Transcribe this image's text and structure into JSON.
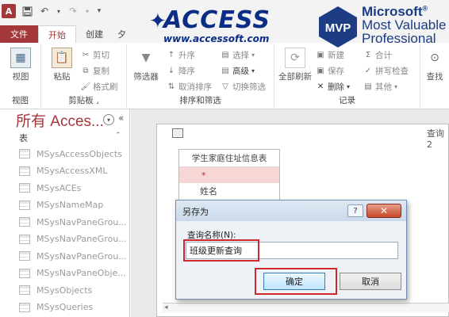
{
  "qat": {
    "app_icon": "A"
  },
  "tabs": {
    "file": "文件",
    "home": "开始",
    "create": "创建",
    "more": "夕"
  },
  "logos": {
    "access_word": "ACCESS",
    "access_url": "www.accessoft.com",
    "mvp_badge": "MVP",
    "mvp_line1": "Microsoft",
    "mvp_line2": "Most Valuable",
    "mvp_line3": "Professional"
  },
  "ribbon": {
    "views": {
      "view_label": "视图",
      "group_label": "视图"
    },
    "clipboard": {
      "paste": "粘贴",
      "cut": "剪切",
      "copy": "复制",
      "format_painter": "格式刷",
      "group_label": "剪贴板"
    },
    "sort_filter": {
      "filter": "筛选器",
      "ascending": "升序",
      "descending": "降序",
      "remove_sort": "取消排序",
      "selection": "选择",
      "advanced": "高级",
      "toggle_filter": "切换筛选",
      "group_label": "排序和筛选"
    },
    "records": {
      "refresh_all": "全部刷新",
      "new": "新建",
      "save": "保存",
      "delete": "删除",
      "totals": "合计",
      "spelling": "拼写检查",
      "more": "其他",
      "group_label": "记录"
    },
    "find": {
      "find": "查找"
    }
  },
  "navpane": {
    "title": "所有 Acces...",
    "section": "表",
    "items": [
      "MSysAccessObjects",
      "MSysAccessXML",
      "MSysACEs",
      "MSysNameMap",
      "MSysNavPaneGrou...",
      "MSysNavPaneGrou...",
      "MSysNavPaneGrou...",
      "MSysNavPaneObje...",
      "MSysObjects",
      "MSysQueries"
    ]
  },
  "query_window": {
    "title": "查询2",
    "table": {
      "name": "学生家庭住址信息表",
      "star": "*",
      "field1": "姓名"
    }
  },
  "dialog": {
    "title": "另存为",
    "help": "?",
    "close": "✕",
    "label": "查询名称(N):",
    "value": "班级更新查询",
    "ok": "确定",
    "cancel": "取消"
  }
}
